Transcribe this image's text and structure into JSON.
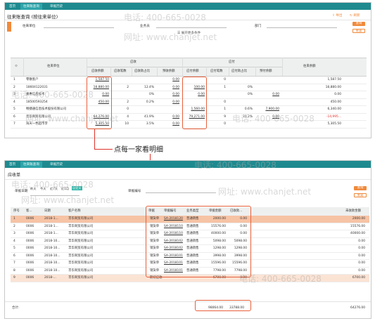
{
  "top": {
    "tabs": [
      "首页",
      "往来账查询",
      "单据历史"
    ],
    "page_title": "往来账查询 (按往来单位)",
    "export_label": "导出",
    "refresh_label": "刷新",
    "filters": {
      "unit_label": "往来单位",
      "staff_label": "业务员",
      "dept_label": "部门",
      "expand_label": "展开更多条件",
      "query_label": "查询",
      "reset_label": "重置"
    },
    "headers": {
      "unit": "往来单位",
      "receivable": "应收",
      "payable": "应付",
      "balance": "往来余额",
      "r_balance": "应收余额",
      "r_count": "应收笔数",
      "r_ratio": "应收款占比",
      "r_pre": "预收余额",
      "p_balance": "应付余额",
      "p_count": "应付笔数",
      "p_ratio": "应付款占比",
      "p_pre": "预付余额"
    },
    "rows": [
      {
        "no": "1",
        "unit": "零散客户",
        "rb": "1,587.50",
        "rc": "",
        "rr": "",
        "rp": "0.00",
        "pb": "",
        "pc": "0",
        "pr": "",
        "pp": "",
        "bal": "1,587.50"
      },
      {
        "no": "2",
        "unit": "18604122031",
        "rb": "18,880.00",
        "rc": "2",
        "rr": "12.4%",
        "rp": "0.00",
        "pb": "100.00",
        "pc": "1",
        "pr": "0%",
        "pp": "",
        "bal": "18,880.00"
      },
      {
        "no": "3",
        "unit": "嘉惠信息技术",
        "rb": "0.00",
        "rc": "",
        "rr": "0%",
        "rp": "0.00",
        "pb": "0.00",
        "pc": "",
        "pr": "0%",
        "pp": "0.00",
        "bal": "0.00"
      },
      {
        "no": "4",
        "unit": "18500593254",
        "rb": "450.00",
        "rc": "2",
        "rr": "0.2%",
        "rp": "0.00",
        "pb": "",
        "pc": "0",
        "pr": "",
        "pp": "",
        "bal": "450.00"
      },
      {
        "no": "5",
        "unit": "畅捷通信息技术股份有限公司",
        "rb": "",
        "rc": "0",
        "rr": "",
        "rp": "",
        "pb": "1,560.00",
        "pc": "1",
        "pr": "0.6%",
        "pp": "7,900.00",
        "bal": "6,340.00"
      },
      {
        "no": "6",
        "unit": "丰华商贸有限公司",
        "rb": "64,276.00",
        "rc": "4",
        "rr": "41.9%",
        "rp": "0.00",
        "pb": "79,271.00",
        "pc": "9",
        "pr": "31.2%",
        "pp": "0.00",
        "bal": "-14,995..."
      },
      {
        "no": "7",
        "unit": "海天一色超市李",
        "rb": "5,305.50",
        "rc": "10",
        "rr": "3.5%",
        "rp": "0.00",
        "pb": "",
        "pc": "0",
        "pr": "",
        "pp": "",
        "bal": "5,305.50"
      }
    ]
  },
  "annotation": "点每一家看明细",
  "watermark": {
    "phone": "电话: 400-665-0028",
    "site": "网址: www.chanjet.net"
  },
  "detail": {
    "tabs": [
      "首页",
      "往来账查询",
      "单据历史"
    ],
    "page_title": "应收单",
    "date_label": "单据日期",
    "date_options": [
      "昨天",
      "今天",
      "近7天",
      "近1月",
      "自定义"
    ],
    "doc_no_label": "单据编号",
    "query_label": "查询",
    "reset_label": "重置",
    "headers": {
      "no": "序号",
      "cust_code": "客...",
      "date": "日期",
      "cust_name": "客户名称",
      "doc": "单据",
      "doc_no": "单据编号",
      "biz": "业务类型",
      "amount": "单据金额",
      "received": "已收款...",
      "unpaid": "未收款金额"
    },
    "rows": [
      {
        "no": "1",
        "code": "0006",
        "date": "2018-1...",
        "name": "丰华商贸有限公司",
        "doc": "销货单",
        "docno": "SA-2018120",
        "biz": "普通销售",
        "amt": "2000.00",
        "rec": "0.00",
        "unpaid": "2000.00"
      },
      {
        "no": "2",
        "code": "0006",
        "date": "2018-1...",
        "name": "丰华商贸有限公司",
        "doc": "销货单",
        "docno": "SA-2018110",
        "biz": "普通销售",
        "amt": "15576.00",
        "rec": "0.00",
        "unpaid": "15576.00"
      },
      {
        "no": "3",
        "code": "0006",
        "date": "2018-1...",
        "name": "丰华商贸有限公司",
        "doc": "销货单",
        "docno": "SA-2018110",
        "biz": "普通销售",
        "amt": "40000.00",
        "rec": "0.00",
        "unpaid": "40000.00"
      },
      {
        "no": "4",
        "code": "0006",
        "date": "2018-10...",
        "name": "丰华商贸有限公司",
        "doc": "销货单",
        "docno": "SA-2018102",
        "biz": "普通销售",
        "amt": "5098.00",
        "rec": "5098.00",
        "unpaid": "0.00"
      },
      {
        "no": "5",
        "code": "0006",
        "date": "2018-10...",
        "name": "丰华商贸有限公司",
        "doc": "销货单",
        "docno": "SA-2018102",
        "biz": "普通销售",
        "amt": "1298.00",
        "rec": "1298.00",
        "unpaid": "0.00"
      },
      {
        "no": "6",
        "code": "0006",
        "date": "2018-10...",
        "name": "丰华商贸有限公司",
        "doc": "销货单",
        "docno": "SA-2018101",
        "biz": "普通销售",
        "amt": "3998.00",
        "rec": "3998.00",
        "unpaid": "0.00"
      },
      {
        "no": "7",
        "code": "0006",
        "date": "2018-10...",
        "name": "丰华商贸有限公司",
        "doc": "销货单",
        "docno": "SA-2018101",
        "biz": "普通销售",
        "amt": "15596.00",
        "rec": "15596.00",
        "unpaid": "0.00"
      },
      {
        "no": "8",
        "code": "0006",
        "date": "2018-10...",
        "name": "丰华商贸有限公司",
        "doc": "销货单",
        "docno": "SA-2018101",
        "biz": "普通销售",
        "amt": "7798.00",
        "rec": "7798.00",
        "unpaid": "0.00"
      },
      {
        "no": "9",
        "code": "0006",
        "date": "2018-...",
        "name": "丰华商贸有限公司",
        "doc": "期初应收",
        "docno": "",
        "biz": "",
        "amt": "6700.00",
        "rec": "0.00",
        "unpaid": "6700.00"
      }
    ],
    "total_label": "合计:",
    "total_amount": "98064.00",
    "total_received": "33788.00",
    "total_unpaid": "64276.00"
  },
  "colors": {
    "teal": "#1e8a8f",
    "orange": "#f08a3c",
    "red": "#e8603b"
  }
}
